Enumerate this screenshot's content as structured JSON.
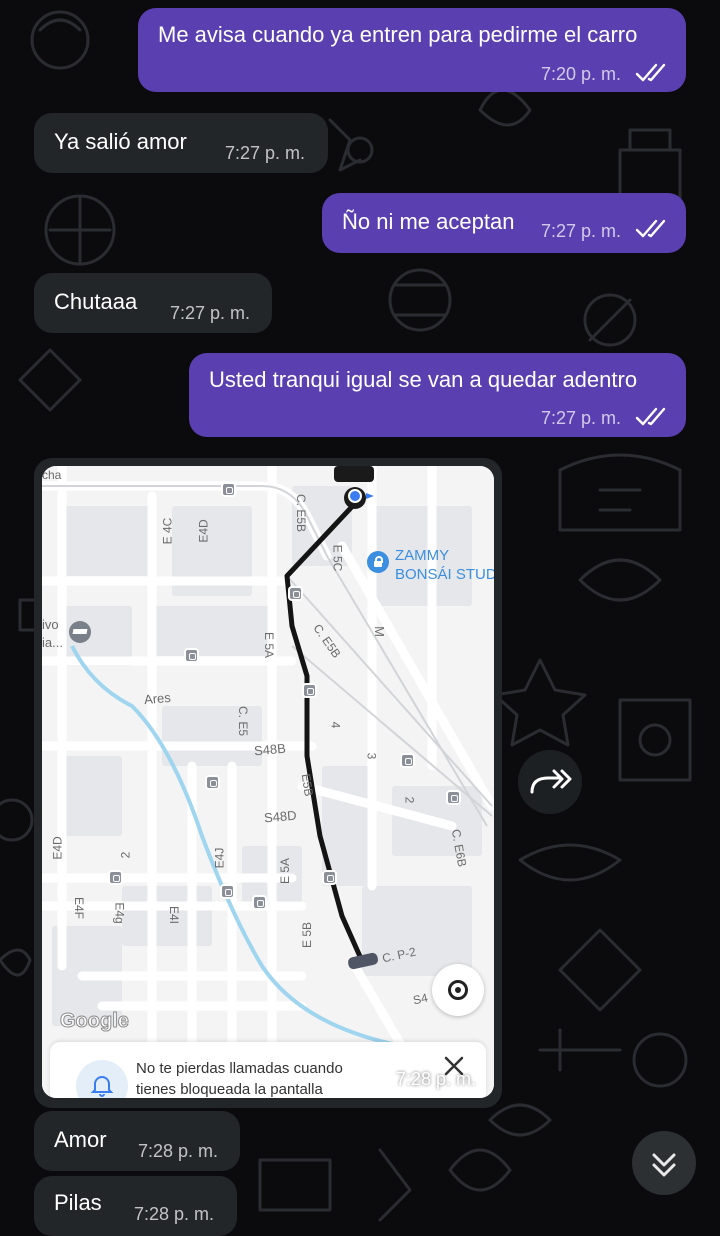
{
  "messages": [
    {
      "dir": "out",
      "text": "Me avisa cuando ya entren para pedirme el carro",
      "time": "7:20 p. m.",
      "read": true
    },
    {
      "dir": "in",
      "text": "Ya salió amor",
      "time": "7:27 p. m."
    },
    {
      "dir": "out",
      "text": "Ño ni me aceptan",
      "time": "7:27 p. m.",
      "read": true
    },
    {
      "dir": "in",
      "text": "Chutaaa",
      "time": "7:27 p. m."
    },
    {
      "dir": "out",
      "text": "Usted tranqui igual se van a quedar adentro",
      "time": "7:27 p. m.",
      "read": true
    },
    {
      "dir": "in",
      "type": "image",
      "time": "7:28 p. m."
    },
    {
      "dir": "in",
      "text": "Amor",
      "time": "7:28 p. m."
    },
    {
      "dir": "in",
      "text": "Pilas",
      "time": "7:28 p. m."
    }
  ],
  "map": {
    "labels": [
      "cha",
      "E 4C",
      "E4D",
      "C. E5B",
      "E 5C",
      "ZAMMY",
      "BONSÁI STUD",
      "ivo",
      "ia...",
      "M",
      "E 5A",
      "C. E5B",
      "Ares",
      "C. E5",
      "4",
      "3",
      "S48B",
      "E5B",
      "2",
      "S48D",
      "C. E6B",
      "E4D",
      "2",
      "E4J",
      "E 5A",
      "E4F",
      "E4g",
      "E4I",
      "E 5B",
      "C. P-2",
      "S4"
    ],
    "watermark": "Google",
    "notification": {
      "line1": "No te pierdas llamadas cuando",
      "line2": "tienes bloqueada la pantalla"
    }
  },
  "icons": {
    "read_ticks": "double-check-icon",
    "forward": "forward-icon",
    "scroll_down": "double-chevron-down-icon",
    "bell": "bell-icon",
    "close": "close-icon",
    "target": "location-target-icon",
    "school": "school-icon",
    "lock": "lock-icon"
  },
  "colors": {
    "outgoing_bubble": "#5a3fb0",
    "incoming_bubble": "#232628",
    "background": "#0b0b0d",
    "route": "#1a1a1a",
    "map_blue_dot": "#3b7df0",
    "river": "#7fc8e8"
  }
}
